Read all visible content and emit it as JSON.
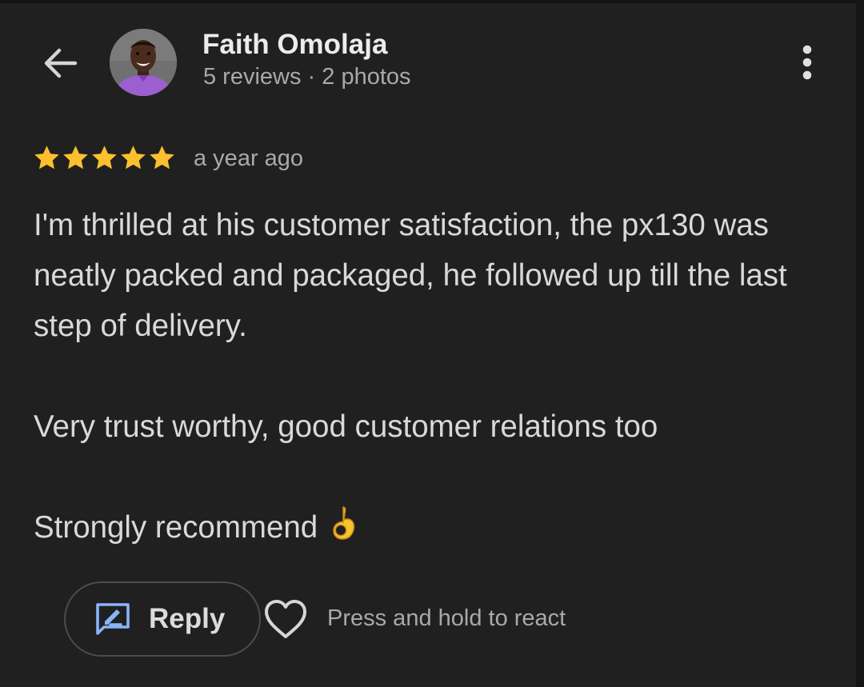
{
  "header": {
    "back_icon": "arrow-left-icon",
    "reviewer_name": "Faith Omolaja",
    "reviewer_meta": "5 reviews · 2 photos",
    "more_icon": "more-vertical-icon"
  },
  "review": {
    "rating": 5,
    "rating_max": 5,
    "star_color": "#fbc02d",
    "time": "a year ago",
    "paragraphs": [
      "I'm thrilled at his customer satisfaction, the px130 was neatly packed and packaged, he followed up till the last step of delivery.",
      "Very trust worthy, good customer relations too",
      "Strongly recommend"
    ],
    "emoji": "ok-hand-emoji"
  },
  "actions": {
    "reply_label": "Reply",
    "reply_icon": "rate-review-icon",
    "heart_icon": "heart-outline-icon",
    "react_hint": "Press and hold to react"
  },
  "colors": {
    "background": "#202020",
    "accent": "#8ab4f8"
  }
}
